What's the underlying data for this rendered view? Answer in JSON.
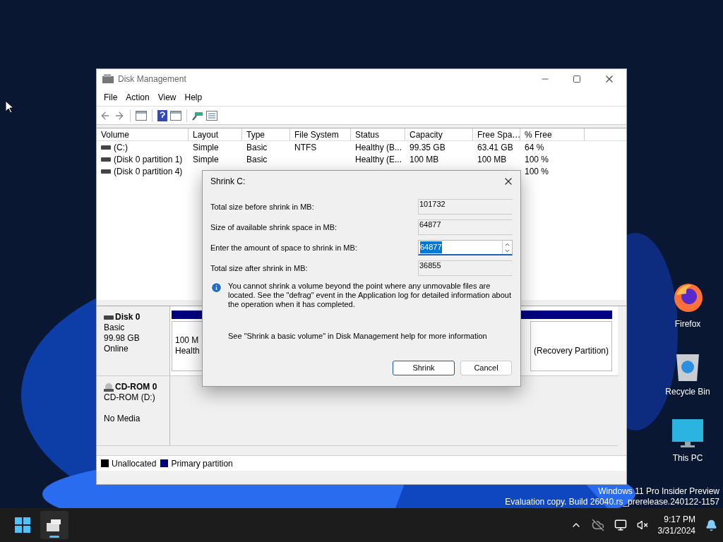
{
  "window": {
    "title": "Disk Management",
    "menu": [
      "File",
      "Action",
      "View",
      "Help"
    ]
  },
  "volumes": {
    "columns": [
      "Volume",
      "Layout",
      "Type",
      "File System",
      "Status",
      "Capacity",
      "Free Spa…",
      "% Free"
    ],
    "rows": [
      {
        "cells": [
          "(C:)",
          "Simple",
          "Basic",
          "NTFS",
          "Healthy (B...",
          "99.35 GB",
          "63.41 GB",
          "64 %"
        ]
      },
      {
        "cells": [
          "(Disk 0 partition 1)",
          "Simple",
          "Basic",
          "",
          "Healthy (E...",
          "100 MB",
          "100 MB",
          "100 %"
        ]
      },
      {
        "cells": [
          "(Disk 0 partition 4)",
          "",
          "",
          "",
          "",
          "",
          "",
          "100 %"
        ]
      }
    ]
  },
  "disks": [
    {
      "kind": "disk",
      "name": "Disk 0",
      "lines": [
        "Basic",
        "99.98 GB",
        "Online"
      ],
      "partitions": [
        {
          "lines": [
            "100 M",
            "Health"
          ]
        },
        {
          "lines": [
            "(Recovery Partition)"
          ]
        }
      ]
    },
    {
      "kind": "cdrom",
      "name": "CD-ROM 0",
      "lines": [
        "CD-ROM (D:)",
        "No Media"
      ]
    }
  ],
  "legend": [
    {
      "label": "Unallocated",
      "color": "#000000"
    },
    {
      "label": "Primary partition",
      "color": "#000080"
    }
  ],
  "dialog": {
    "title": "Shrink C:",
    "fields": [
      {
        "kind": "readonly",
        "label": "Total size before shrink in MB:",
        "value": "101732",
        "selected": false
      },
      {
        "kind": "readonly",
        "label": "Size of available shrink space in MB:",
        "value": "64877",
        "selected": false
      },
      {
        "kind": "spin",
        "label": "Enter the amount of space to shrink in MB:",
        "value": "64877",
        "selected": true
      },
      {
        "kind": "readonly",
        "label": "Total size after shrink in MB:",
        "value": "36855",
        "selected": false
      }
    ],
    "info": "You cannot shrink a volume beyond the point where any unmovable files are located. See the \"defrag\" event in the Application log for detailed information about the operation when it has completed.",
    "help": "See \"Shrink a basic volume\" in Disk Management help for more information",
    "buttons": [
      {
        "label": "Shrink",
        "default": true
      },
      {
        "label": "Cancel",
        "default": false
      }
    ]
  },
  "desktop_icons": [
    {
      "kind": "firefox",
      "label": "Firefox"
    },
    {
      "kind": "recycle",
      "label": "Recycle Bin"
    },
    {
      "kind": "pc",
      "label": "This PC"
    }
  ],
  "watermark": [
    "Windows 11 Pro Insider Preview",
    "Evaluation copy. Build 26040.rs_prerelease.240122-1157"
  ],
  "taskbar": {
    "time": "9:17 PM",
    "date": "3/31/2024"
  }
}
